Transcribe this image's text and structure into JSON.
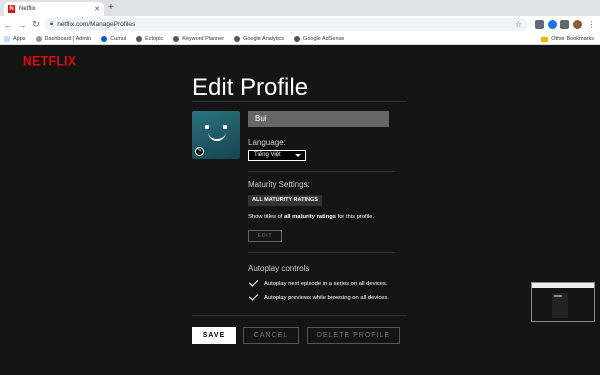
{
  "browser": {
    "tab_title": "Netflix",
    "tab_favicon": "N",
    "url": "netflix.com/ManageProfiles",
    "bookmarks": [
      "Apps",
      "Dashboard | Admin",
      "Cumul",
      "Ectopic",
      "Keyword Planner",
      "Google Analytics",
      "Google AdSense"
    ],
    "other_bookmarks": "Other Bookmarks"
  },
  "brand": {
    "logo": "NETFLIX",
    "color": "#e50914"
  },
  "page": {
    "title": "Edit Profile",
    "profile_name": "Bui",
    "language_label": "Language:",
    "language_value": "Tiếng Việt",
    "maturity_label": "Maturity Settings:",
    "maturity_chip": "ALL MATURITY RATINGS",
    "maturity_desc_pre": "Show titles of ",
    "maturity_desc_bold": "all maturity ratings",
    "maturity_desc_post": " for this profile.",
    "edit_button": "EDIT",
    "autoplay_label": "Autoplay controls",
    "autoplay_next": "Autoplay next episode in a series on all devices.",
    "autoplay_previews": "Autoplay previews while browsing on all devices.",
    "save_button": "SAVE",
    "cancel_button": "CANCEL",
    "delete_button": "DELETE PROFILE"
  }
}
